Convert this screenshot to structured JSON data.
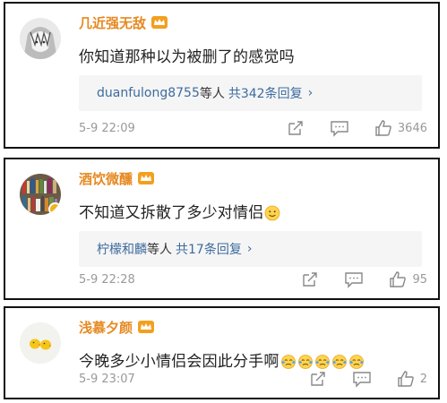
{
  "comments": [
    {
      "username": "几近强无敌",
      "content": "你知道那种以为被删了的感觉吗",
      "reply": {
        "user": "duanfulong8755",
        "middle": "等人",
        "count": "共342条回复",
        "chevron": "›"
      },
      "time": "5-9 22:09",
      "likes": "3646",
      "avatar_icon": "anime-avatar-icon"
    },
    {
      "username": "酒饮微醺",
      "content": "不知道又拆散了多少对情侣",
      "content_emoji": "smile-emoji-icon",
      "reply": {
        "user": "柠檬和麟",
        "middle": "等人",
        "count": "共17条回复",
        "chevron": "›"
      },
      "time": "5-9 22:28",
      "likes": "95",
      "avatar_icon": "bookshelf-avatar-icon"
    },
    {
      "username": "浅慕夕颜",
      "content": "今晚多少小情侣会因此分手啊",
      "content_emoji": "crying-emoji-icon",
      "time": "5-9 23:07",
      "likes": "2",
      "avatar_icon": "chicks-avatar-icon"
    }
  ],
  "colors": {
    "username": "#e68a22",
    "link": "#3d6b9f",
    "meta": "#999999",
    "reply_bg": "#f5f5f5"
  }
}
